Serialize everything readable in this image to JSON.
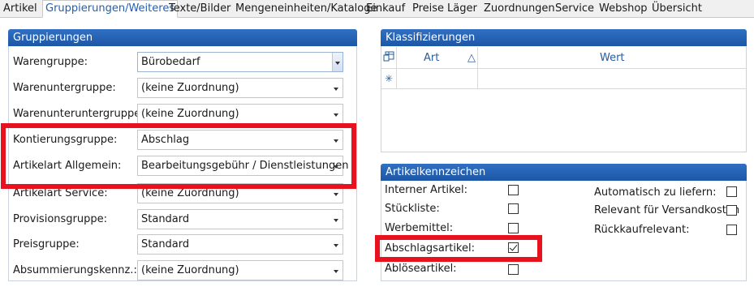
{
  "tabs": [
    {
      "label": "Artikel"
    },
    {
      "label": "Gruppierungen/Weiteres"
    },
    {
      "label": "Texte/Bilder"
    },
    {
      "label": "Mengeneinheiten/Kataloge"
    },
    {
      "label": "Einkauf"
    },
    {
      "label": "Preise"
    },
    {
      "label": "Läger"
    },
    {
      "label": "Zuordnungen"
    },
    {
      "label": "Service"
    },
    {
      "label": "Webshop"
    },
    {
      "label": "Übersicht"
    }
  ],
  "active_tab": "Gruppierungen/Weiteres",
  "gruppierungen": {
    "title": "Gruppierungen",
    "fields": [
      {
        "label": "Warengruppe:",
        "value": "Bürobedarf"
      },
      {
        "label": "Warenuntergruppe:",
        "value": "(keine Zuordnung)"
      },
      {
        "label": "Warenunteruntergruppe:",
        "value": "(keine Zuordnung)"
      },
      {
        "label": "Kontierungsgruppe:",
        "value": "Abschlag"
      },
      {
        "label": "Artikelart Allgemein:",
        "value": "Bearbeitungsgebühr / Dienstleistungen"
      },
      {
        "label": "Artikelart Service:",
        "value": "(keine Zuordnung)"
      },
      {
        "label": "Provisionsgruppe:",
        "value": "Standard"
      },
      {
        "label": "Preisgruppe:",
        "value": "Standard"
      },
      {
        "label": "Absummierungskennz.:",
        "value": "(keine Zuordnung)"
      }
    ]
  },
  "klassifizierungen": {
    "title": "Klassifizierungen",
    "columns": [
      "Art",
      "Wert"
    ],
    "sort_indicator": "△",
    "new_row_marker": "✳"
  },
  "artikelkennzeichen": {
    "title": "Artikelkennzeichen",
    "left": [
      {
        "label": "Interner Artikel:",
        "checked": false
      },
      {
        "label": "Stückliste:",
        "checked": false
      },
      {
        "label": "Werbemittel:",
        "checked": false
      },
      {
        "label": "Abschlagsartikel:",
        "checked": true
      },
      {
        "label": "Ablöseartikel:",
        "checked": false
      }
    ],
    "right": [
      {
        "label": "Automatisch zu liefern:",
        "checked": false
      },
      {
        "label": "Relevant für Versandkosten",
        "checked": false
      },
      {
        "label": "Rückkaufrelevant:",
        "checked": false
      }
    ]
  },
  "colors": {
    "accent": "#1d56a6",
    "highlight": "#e8121f",
    "active_tab_text": "#1f5fb3"
  }
}
